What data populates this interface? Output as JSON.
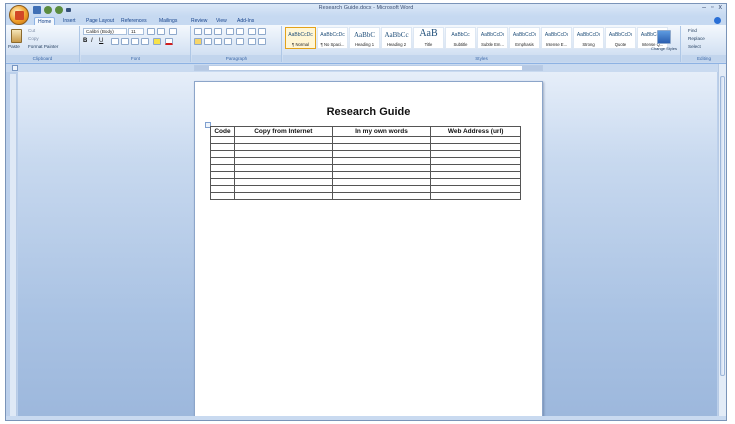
{
  "window": {
    "title": "Research Guide.docx - Microsoft Word",
    "controls": [
      "–",
      "▫",
      "x"
    ]
  },
  "tabs": [
    {
      "label": "Home",
      "active": true
    },
    {
      "label": "Insert",
      "active": false
    },
    {
      "label": "Page Layout",
      "active": false
    },
    {
      "label": "References",
      "active": false
    },
    {
      "label": "Mailings",
      "active": false
    },
    {
      "label": "Review",
      "active": false
    },
    {
      "label": "View",
      "active": false
    },
    {
      "label": "Add-Ins",
      "active": false
    }
  ],
  "ribbon": {
    "clipboard": {
      "label": "Clipboard",
      "paste": "Paste",
      "cut": "Cut",
      "copy": "Copy",
      "format_painter": "Format Painter"
    },
    "font": {
      "label": "Font",
      "font_name": "Calibri (Body)",
      "font_size": "11"
    },
    "paragraph": {
      "label": "Paragraph"
    },
    "styles": {
      "label": "Styles",
      "tiles": [
        {
          "sample": "AaBbCcDc",
          "name": "¶ Normal",
          "selected": true,
          "kind": "normal"
        },
        {
          "sample": "AaBbCcDc",
          "name": "¶ No Spaci...",
          "selected": false,
          "kind": "normal"
        },
        {
          "sample": "AaBbC",
          "name": "Heading 1",
          "selected": false,
          "kind": "h"
        },
        {
          "sample": "AaBbCc",
          "name": "Heading 2",
          "selected": false,
          "kind": "h"
        },
        {
          "sample": "AaB",
          "name": "Title",
          "selected": false,
          "kind": "big"
        },
        {
          "sample": "AaBbCc",
          "name": "Subtitle",
          "selected": false,
          "kind": "normal"
        },
        {
          "sample": "AaBbCcDı",
          "name": "Subtle Em...",
          "selected": false,
          "kind": "normal"
        },
        {
          "sample": "AaBbCcDı",
          "name": "Emphasis",
          "selected": false,
          "kind": "normal"
        },
        {
          "sample": "AaBbCcDı",
          "name": "Intense E...",
          "selected": false,
          "kind": "normal"
        },
        {
          "sample": "AaBbCcDı",
          "name": "Strong",
          "selected": false,
          "kind": "normal"
        },
        {
          "sample": "AaBbCcDı",
          "name": "Quote",
          "selected": false,
          "kind": "normal"
        },
        {
          "sample": "AaBbCcDı",
          "name": "Intense Q...",
          "selected": false,
          "kind": "normal"
        }
      ],
      "change_styles": "Change Styles"
    },
    "editing": {
      "label": "Editing",
      "find": "Find",
      "replace": "Replace",
      "select": "Select"
    }
  },
  "document": {
    "title": "Research Guide",
    "table": {
      "headers": [
        "Code",
        "Copy from Internet",
        "In my own words",
        "Web Address  (url)"
      ],
      "empty_rows": 9
    }
  },
  "colors": {
    "frame": "#bcd0eb",
    "ribbon": "#dae6f5",
    "accent": "#15428b"
  }
}
